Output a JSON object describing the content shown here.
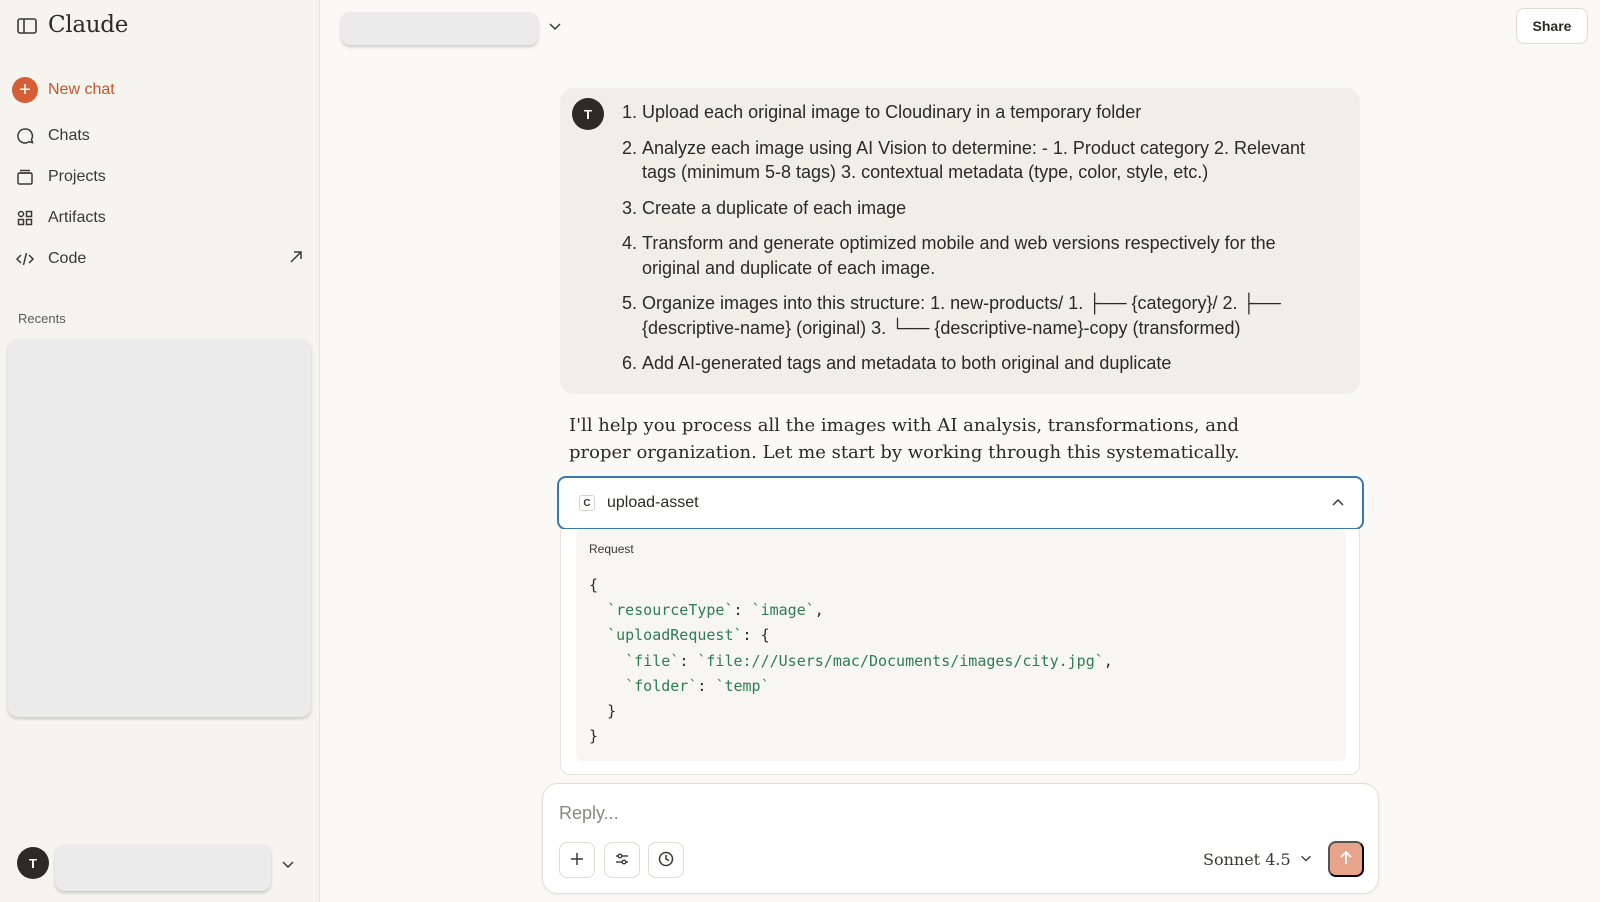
{
  "app": {
    "brand": "Claude"
  },
  "sidebar": {
    "new_chat": "New chat",
    "items": [
      {
        "label": "Chats",
        "icon": "chat-bubble-icon"
      },
      {
        "label": "Projects",
        "icon": "folder-icon"
      },
      {
        "label": "Artifacts",
        "icon": "artifacts-icon"
      },
      {
        "label": "Code",
        "icon": "code-icon"
      }
    ],
    "recents_label": "Recents",
    "user_initial": "T"
  },
  "header": {
    "share_label": "Share"
  },
  "user_message": {
    "avatar_initial": "T",
    "items": [
      {
        "num": "1.",
        "text": "Upload each original image to Cloudinary in a temporary folder"
      },
      {
        "num": "2.",
        "text": "Analyze each image using AI Vision to determine: - 1. Product category 2. Relevant tags (minimum 5-8 tags) 3. contextual metadata (type, color, style, etc.)"
      },
      {
        "num": "3.",
        "text": "Create a duplicate of each image"
      },
      {
        "num": "4.",
        "text": "Transform and generate optimized mobile and web versions respectively for the original and duplicate of each image."
      },
      {
        "num": "5.",
        "text": "Organize images into this structure: 1. new-products/ 1. ├── {category}/ 2. ├── {descriptive-name} (original) 3. └── {descriptive-name}-copy (transformed)"
      },
      {
        "num": "6.",
        "text": "Add AI-generated tags and metadata to both original and duplicate"
      }
    ]
  },
  "assistant": {
    "text": "I'll help you process all the images with AI analysis, transformations, and proper organization. Let me start by working through this systematically."
  },
  "tool": {
    "badge": "C",
    "name": "upload-asset",
    "request_label": "Request",
    "code": {
      "open": "{",
      "k_resource": "`resourceType`",
      "v_resource": "`image`",
      "k_upload": "`uploadRequest`",
      "k_file": "`file`",
      "v_file": "`file:///Users/mac/Documents/images/city.jpg`",
      "k_folder": "`folder`",
      "v_folder": "`temp`",
      "inner_close": "}",
      "close": "}"
    }
  },
  "composer": {
    "placeholder": "Reply...",
    "model": "Sonnet 4.5"
  },
  "colors": {
    "accent": "#d45f35",
    "focus_border": "#3a78b5",
    "send_button": "#e8a48a",
    "code_string": "#2f7d52"
  }
}
